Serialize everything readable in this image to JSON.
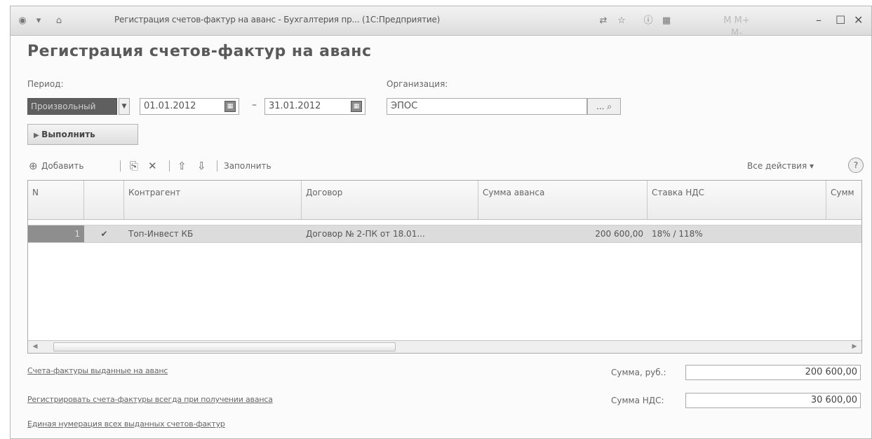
{
  "window": {
    "title": "Регистрация счетов-фактур на аванс - Бухгалтерия пр... (1С:Предприятие)"
  },
  "form": {
    "heading": "Регистрация счетов-фактур на аванс",
    "period_label": "Период:",
    "period_type": "Произвольный",
    "date_from": "01.01.2012",
    "date_to": "31.01.2012",
    "dash": "–",
    "org_label": "Организация:",
    "org_value": "ЭПОС",
    "org_select_btn": "...",
    "run_button": "Выполнить"
  },
  "toolbar": {
    "add_label": "Добавить",
    "fill_label": "Заполнить",
    "all_actions_label": "Все действия"
  },
  "table": {
    "columns": {
      "num": "N",
      "flag": "",
      "counterparty": "Контрагент",
      "contract": "Договор",
      "advance_sum": "Сумма аванса",
      "vat_rate": "Ставка НДС",
      "sum": "Сумм"
    },
    "rows": [
      {
        "num": "1",
        "checked": true,
        "counterparty": "Топ-Инвест КБ",
        "contract": "Договор № 2-ПК от 18.01...",
        "advance_sum": "200 600,00",
        "vat_rate": "18% / 118%",
        "sum": ""
      }
    ]
  },
  "footer": {
    "link_issued": "Счета-фактуры выданные на аванс",
    "link_register_always": "Регистрировать счета-фактуры всегда при получении аванса",
    "link_numbering": "Единая нумерация всех выданных счетов-фактур",
    "sum_rub_label": "Сумма, руб.:",
    "sum_rub_value": "200 600,00",
    "sum_vat_label": "Сумма НДС:",
    "sum_vat_value": "30 600,00"
  },
  "icons": {
    "checkmark": "check-icon",
    "calendar": "calendar-icon",
    "search": "search-icon",
    "help": "help-icon"
  }
}
